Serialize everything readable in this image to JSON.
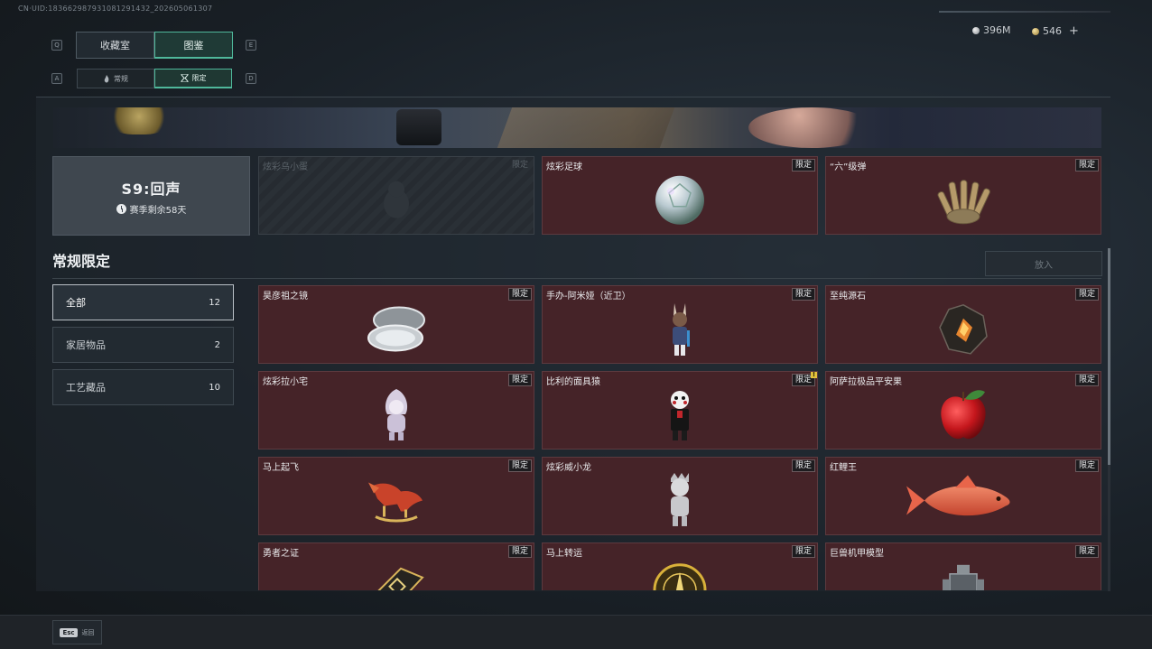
{
  "header": {
    "uid": "CN·UID:18366298793108129143​2_202605061307",
    "currency_silver": "396M",
    "currency_gold": "546",
    "plus": "+"
  },
  "tabs": {
    "left_key": "Q",
    "right_key": "E",
    "items": [
      {
        "label": "收藏室"
      },
      {
        "label": "图鉴"
      }
    ]
  },
  "subtabs": {
    "left_key": "A",
    "right_key": "D",
    "items": [
      {
        "label": "常规"
      },
      {
        "label": "限定"
      }
    ]
  },
  "season": {
    "title": "S9:回声",
    "remaining": "赛季剩余58天"
  },
  "featured": [
    {
      "name": "炫彩乌小蛋",
      "tag": "限定"
    },
    {
      "name": "炫彩足球",
      "tag": "限定"
    },
    {
      "name": "“六”级弹",
      "tag": "限定"
    }
  ],
  "section": {
    "title": "常规限定",
    "put_in": "放入"
  },
  "filters": [
    {
      "label": "全部",
      "count": "12"
    },
    {
      "label": "家居物品",
      "count": "2"
    },
    {
      "label": "工艺藏品",
      "count": "10"
    }
  ],
  "items": [
    {
      "name": "昊彦祖之镜",
      "tag": "限定"
    },
    {
      "name": "手办-阿米娅（近卫）",
      "tag": "限定"
    },
    {
      "name": "至纯源石",
      "tag": "限定"
    },
    {
      "name": "炫彩拉小宅",
      "tag": "限定"
    },
    {
      "name": "比利的面具猿",
      "tag": "限定",
      "badge": "!"
    },
    {
      "name": "阿萨拉极品平安果",
      "tag": "限定"
    },
    {
      "name": "马上起飞",
      "tag": "限定"
    },
    {
      "name": "炫彩威小龙",
      "tag": "限定"
    },
    {
      "name": "红鲤王",
      "tag": "限定"
    },
    {
      "name": "勇者之证",
      "tag": "限定"
    },
    {
      "name": "马上转运",
      "tag": "限定"
    },
    {
      "name": "巨兽机甲模型",
      "tag": "限定"
    }
  ],
  "footer": {
    "esc_key": "Esc",
    "back_label": "返回"
  }
}
